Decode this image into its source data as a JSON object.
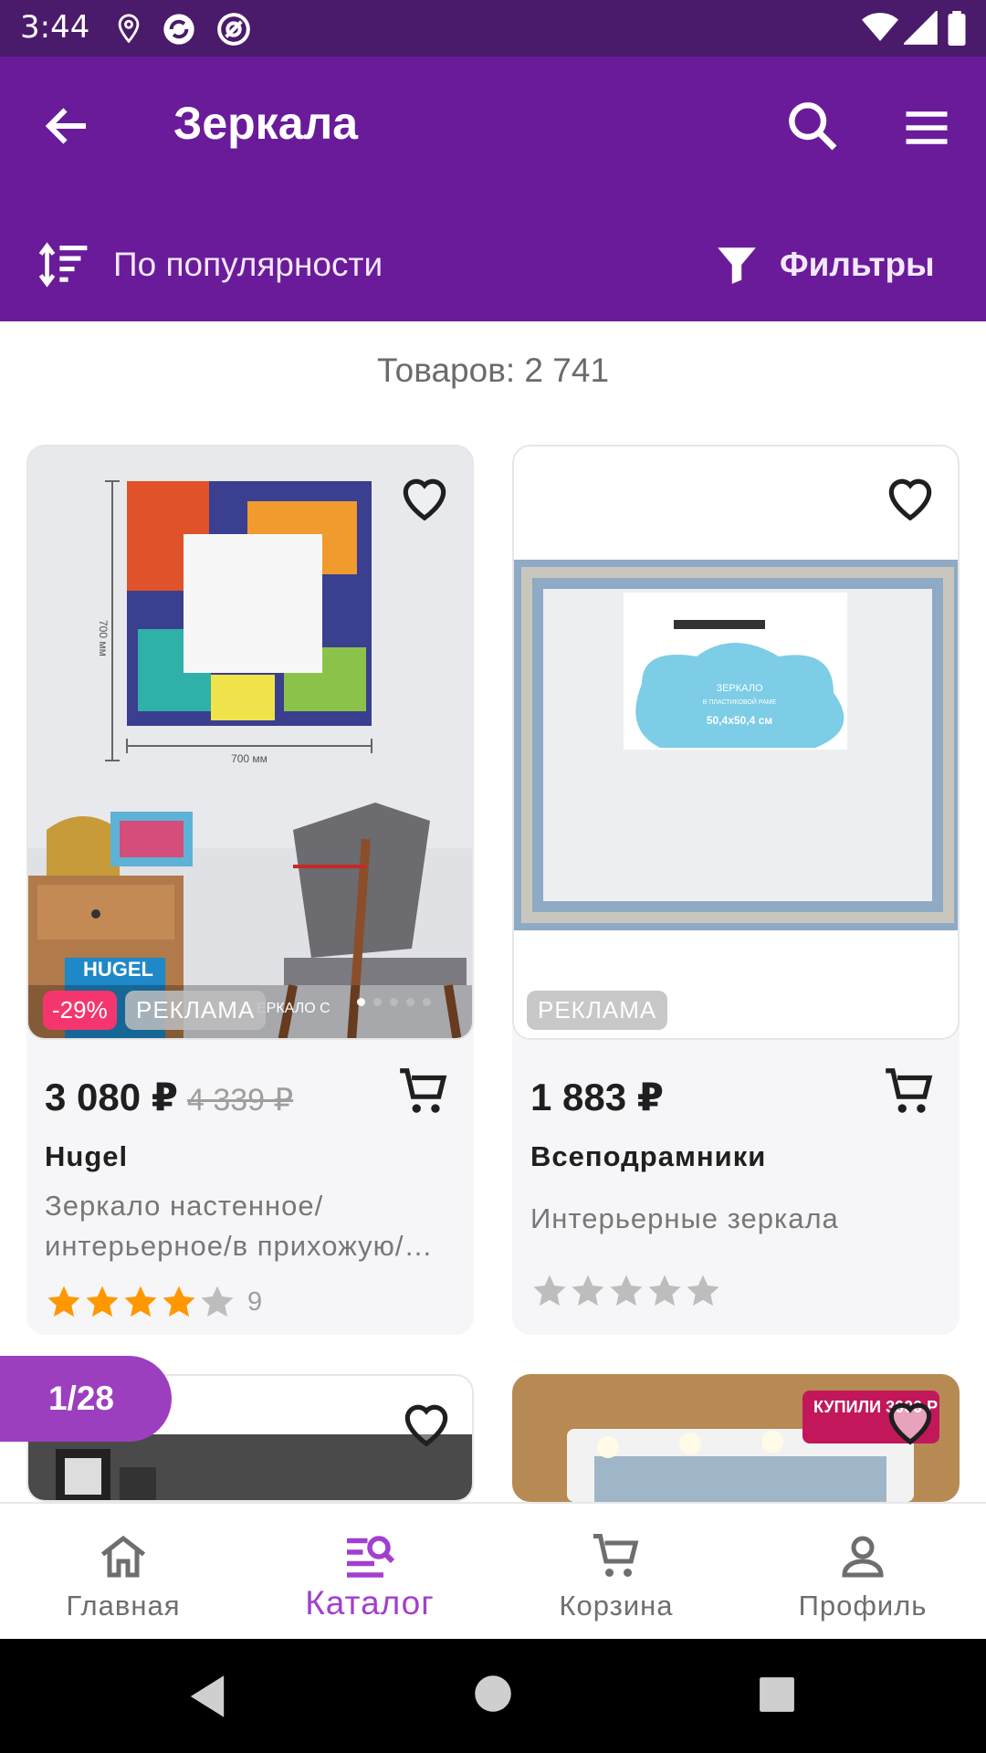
{
  "status_bar": {
    "time": "3:44"
  },
  "app_bar": {
    "title": "Зеркала",
    "sort_label": "По популярности",
    "filters_label": "Фильтры"
  },
  "count_label": "Товаров: 2 741",
  "products": [
    {
      "price": "3 080 ₽",
      "old_price": "4 339 ₽",
      "discount": "-29%",
      "ad_label": "РЕКЛАМА",
      "brand": "Hugel",
      "description": "Зеркало настенное/ интерьерное/в прихожую/…",
      "rating": 4,
      "rating_count": "9",
      "image_caption": "ЕРКАЛО С",
      "image_brand": "HUGEL",
      "dim_horizontal": "700 мм",
      "dim_vertical": "700 мм"
    },
    {
      "price": "1 883 ₽",
      "ad_label": "РЕКЛАМА",
      "brand": "Всеподрамники",
      "description": "Интерьерные зеркала",
      "rating": 0,
      "label_line1": "ЗЕРКАЛО",
      "label_line2": "В ПЛАСТИКОВОЙ РАМЕ",
      "label_line3": "50,4x50,4 см"
    },
    {},
    {
      "promo": "КУПИЛИ 3000 Р"
    }
  ],
  "pager": "1/28",
  "bottom_nav": [
    {
      "label": "Главная",
      "icon": "home-icon"
    },
    {
      "label": "Каталог",
      "icon": "catalog-icon",
      "active": true
    },
    {
      "label": "Корзина",
      "icon": "cart-icon"
    },
    {
      "label": "Профиль",
      "icon": "profile-icon"
    }
  ],
  "colors": {
    "status_bar": "#4a1a6b",
    "app_bar": "#6a1b9a",
    "accent": "#a23fd0",
    "sale_badge": "#f5366e",
    "star": "#ff9800"
  }
}
